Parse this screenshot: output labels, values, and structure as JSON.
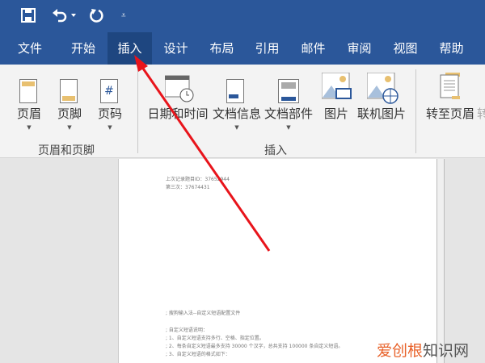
{
  "qat": {
    "icons": [
      "save-icon",
      "undo-icon",
      "redo-icon",
      "customize-icon"
    ]
  },
  "tabs": [
    {
      "label": "文件"
    },
    {
      "label": "开始"
    },
    {
      "label": "插入",
      "active": true
    },
    {
      "label": "设计"
    },
    {
      "label": "布局"
    },
    {
      "label": "引用"
    },
    {
      "label": "邮件"
    },
    {
      "label": "审阅"
    },
    {
      "label": "视图"
    },
    {
      "label": "帮助"
    }
  ],
  "ribbon": {
    "header_footer": {
      "buttons": [
        {
          "label": "页眉"
        },
        {
          "label": "页脚"
        },
        {
          "label": "页码"
        }
      ],
      "group": "页眉和页脚"
    },
    "insert": {
      "buttons": [
        {
          "label": "日期和时间"
        },
        {
          "label": "文档信息"
        },
        {
          "label": "文档部件"
        },
        {
          "label": "图片"
        },
        {
          "label": "联机图片"
        }
      ],
      "group": "插入"
    },
    "nav": {
      "buttons": [
        {
          "label": "转至页眉"
        },
        {
          "label": "转"
        }
      ]
    }
  },
  "document": {
    "header_lines": [
      "上次记录题目ID：37652944",
      "第三次：37674431"
    ],
    "body_lines": [
      ";  搜狗输入法--自定义短语配置文件",
      "",
      ";  自定义短语说明：",
      ";  1、自定义短语支持多行、空格、指定位置。",
      ";  2、每条自定义短语最多支持 30000 个汉字，总共支持 100000 条自定义短语。",
      ";  3、自定义短语的格式如下："
    ]
  },
  "watermark": {
    "brand": "爱创根",
    "suffix": "知识网"
  },
  "colors": {
    "titlebar": "#2b579a",
    "active_tab": "#1e4680",
    "arrow": "#e8141b"
  }
}
